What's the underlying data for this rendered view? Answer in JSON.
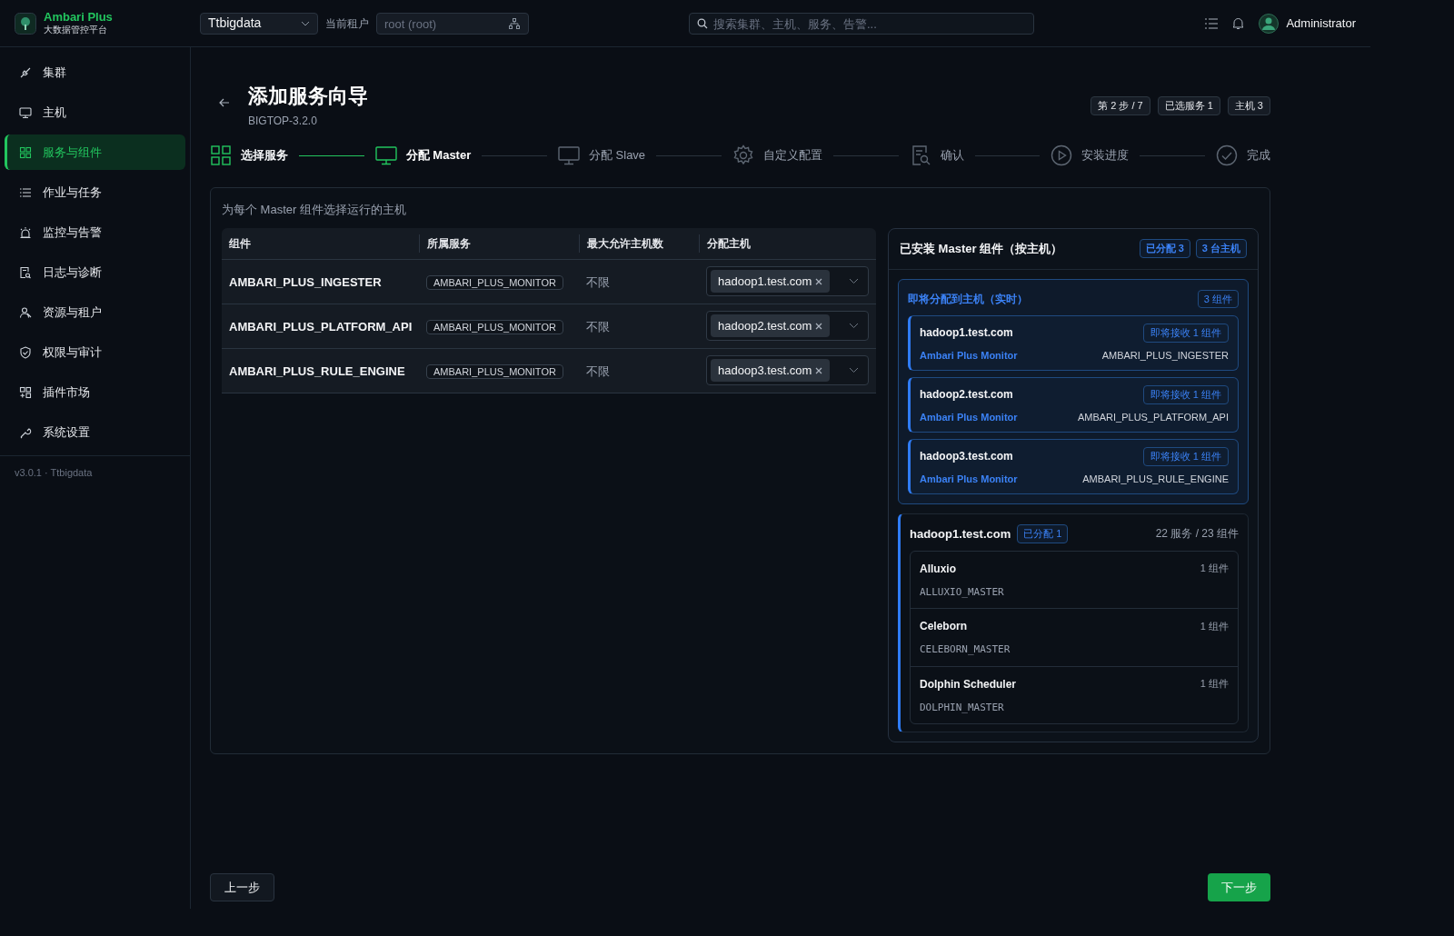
{
  "app": {
    "name": "Ambari Plus",
    "subtitle": "大数据管控平台"
  },
  "topbar": {
    "cluster_select": "Ttbigdata",
    "tenant_label": "当前租户",
    "tenant_field": {
      "placeholder": "root (root)"
    },
    "search": {
      "placeholder": "搜索集群、主机、服务、告警..."
    },
    "user": "Administrator"
  },
  "sidebar": {
    "items": [
      {
        "label": "集群",
        "selected": false
      },
      {
        "label": "主机",
        "selected": false
      },
      {
        "label": "服务与组件",
        "selected": true
      },
      {
        "label": "作业与任务",
        "selected": false
      },
      {
        "label": "监控与告警",
        "selected": false
      },
      {
        "label": "日志与诊断",
        "selected": false
      },
      {
        "label": "资源与租户",
        "selected": false
      },
      {
        "label": "权限与审计",
        "selected": false
      },
      {
        "label": "插件市场",
        "selected": false
      },
      {
        "label": "系统设置",
        "selected": false
      }
    ],
    "version": "v3.0.1 · Ttbigdata"
  },
  "wizard": {
    "title": "添加服务向导",
    "subtitle": "BIGTOP-3.2.0",
    "badges": [
      "第 2 步 / 7",
      "已选服务 1",
      "主机 3"
    ],
    "steps": [
      {
        "label": "选择服务",
        "completed": true,
        "selected": false
      },
      {
        "label": "分配 Master",
        "completed": false,
        "selected": true
      },
      {
        "label": "分配 Slave",
        "completed": false,
        "selected": false
      },
      {
        "label": "自定义配置",
        "completed": false,
        "selected": false
      },
      {
        "label": "确认",
        "completed": false,
        "selected": false
      },
      {
        "label": "安装进度",
        "completed": false,
        "selected": false
      },
      {
        "label": "完成",
        "completed": false,
        "selected": false
      }
    ]
  },
  "assignment": {
    "hint": "为每个 Master 组件选择运行的主机",
    "columns": [
      "组件",
      "所属服务",
      "最大允许主机数",
      "分配主机"
    ],
    "rows": [
      {
        "component": "AMBARI_PLUS_INGESTER",
        "service": "AMBARI_PLUS_MONITOR",
        "max_hosts": "不限",
        "host": "hadoop1.test.com"
      },
      {
        "component": "AMBARI_PLUS_PLATFORM_API",
        "service": "AMBARI_PLUS_MONITOR",
        "max_hosts": "不限",
        "host": "hadoop2.test.com"
      },
      {
        "component": "AMBARI_PLUS_RULE_ENGINE",
        "service": "AMBARI_PLUS_MONITOR",
        "max_hosts": "不限",
        "host": "hadoop3.test.com"
      }
    ]
  },
  "installed_panel": {
    "title": "已安装 Master 组件（按主机）",
    "badges": [
      "已分配 3",
      "3 台主机"
    ],
    "pending": {
      "title": "即将分配到主机（实时）",
      "count": "3 组件",
      "hosts": [
        {
          "host": "hadoop1.test.com",
          "badge": "即将接收 1 组件",
          "service": "Ambari Plus Monitor",
          "component": "AMBARI_PLUS_INGESTER"
        },
        {
          "host": "hadoop2.test.com",
          "badge": "即将接收 1 组件",
          "service": "Ambari Plus Monitor",
          "component": "AMBARI_PLUS_PLATFORM_API"
        },
        {
          "host": "hadoop3.test.com",
          "badge": "即将接收 1 组件",
          "service": "Ambari Plus Monitor",
          "component": "AMBARI_PLUS_RULE_ENGINE"
        }
      ]
    },
    "host_group": {
      "host": "hadoop1.test.com",
      "badge": "已分配 1",
      "summary": "22 服务 / 23 组件",
      "services": [
        {
          "name": "Alluxio",
          "count": "1 组件",
          "component": "ALLUXIO_MASTER"
        },
        {
          "name": "Celeborn",
          "count": "1 组件",
          "component": "CELEBORN_MASTER"
        },
        {
          "name": "Dolphin Scheduler",
          "count": "1 组件",
          "component": "DOLPHIN_MASTER"
        }
      ]
    }
  },
  "footer": {
    "prev": "上一步",
    "next": "下一步"
  }
}
